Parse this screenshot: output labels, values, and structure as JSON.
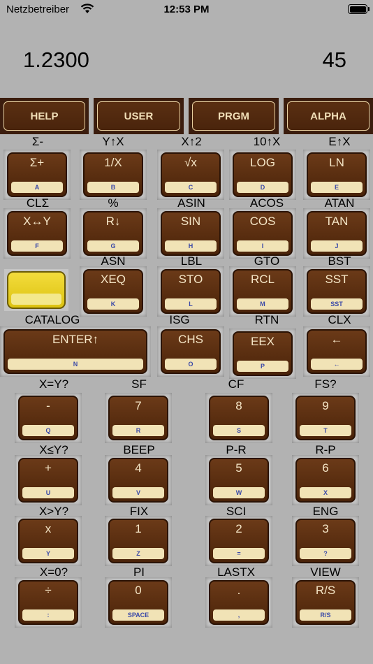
{
  "status_bar": {
    "carrier": "Netzbetreiber",
    "time": "12:53 PM"
  },
  "display": {
    "x_value": "1.2300",
    "right_value": "45"
  },
  "mode_keys": [
    "HELP",
    "USER",
    "PRGM",
    "ALPHA"
  ],
  "rows": [
    {
      "shift_labels": [
        "Σ-",
        "Y↑X",
        "X↑2",
        "10↑X",
        "E↑X"
      ],
      "keys": [
        {
          "label": "Σ+",
          "sub": "A"
        },
        {
          "label": "1/X",
          "sub": "B"
        },
        {
          "label": "√x",
          "sub": "C"
        },
        {
          "label": "LOG",
          "sub": "D"
        },
        {
          "label": "LN",
          "sub": "E"
        }
      ]
    },
    {
      "shift_labels": [
        "CLΣ",
        "%",
        "ASIN",
        "ACOS",
        "ATAN"
      ],
      "keys": [
        {
          "label": "X↔Y",
          "sub": "F"
        },
        {
          "label": "R↓",
          "sub": "G"
        },
        {
          "label": "SIN",
          "sub": "H"
        },
        {
          "label": "COS",
          "sub": "I"
        },
        {
          "label": "TAN",
          "sub": "J"
        }
      ]
    },
    {
      "shift_labels": [
        "",
        "ASN",
        "LBL",
        "GTO",
        "BST"
      ],
      "keys": [
        {
          "label": "",
          "sub": ""
        },
        {
          "label": "XEQ",
          "sub": "K"
        },
        {
          "label": "STO",
          "sub": "L"
        },
        {
          "label": "RCL",
          "sub": "M"
        },
        {
          "label": "SST",
          "sub": "SST"
        }
      ]
    },
    {
      "shift_labels": [
        "CATALOG",
        "ISG",
        "RTN",
        "CLX"
      ],
      "keys": [
        {
          "label": "ENTER↑",
          "sub": "N"
        },
        {
          "label": "CHS",
          "sub": "O"
        },
        {
          "label": "EEX",
          "sub": "P"
        },
        {
          "label": "←",
          "sub": "←"
        }
      ]
    },
    {
      "shift_labels": [
        "X=Y?",
        "SF",
        "CF",
        "FS?"
      ],
      "keys": [
        {
          "label": "-",
          "sub": "Q"
        },
        {
          "label": "7",
          "sub": "R"
        },
        {
          "label": "8",
          "sub": "S"
        },
        {
          "label": "9",
          "sub": "T"
        }
      ]
    },
    {
      "shift_labels": [
        "X≤Y?",
        "BEEP",
        "P-R",
        "R-P"
      ],
      "keys": [
        {
          "label": "+",
          "sub": "U"
        },
        {
          "label": "4",
          "sub": "V"
        },
        {
          "label": "5",
          "sub": "W"
        },
        {
          "label": "6",
          "sub": "X"
        }
      ]
    },
    {
      "shift_labels": [
        "X>Y?",
        "FIX",
        "SCI",
        "ENG"
      ],
      "keys": [
        {
          "label": "x",
          "sub": "Y"
        },
        {
          "label": "1",
          "sub": "Z"
        },
        {
          "label": "2",
          "sub": "="
        },
        {
          "label": "3",
          "sub": "?"
        }
      ]
    },
    {
      "shift_labels": [
        "X=0?",
        "PI",
        "LASTX",
        "VIEW"
      ],
      "keys": [
        {
          "label": "÷",
          "sub": ":"
        },
        {
          "label": "0",
          "sub": "SPACE"
        },
        {
          "label": ".",
          "sub": ","
        },
        {
          "label": "R/S",
          "sub": "R/S"
        }
      ]
    }
  ]
}
